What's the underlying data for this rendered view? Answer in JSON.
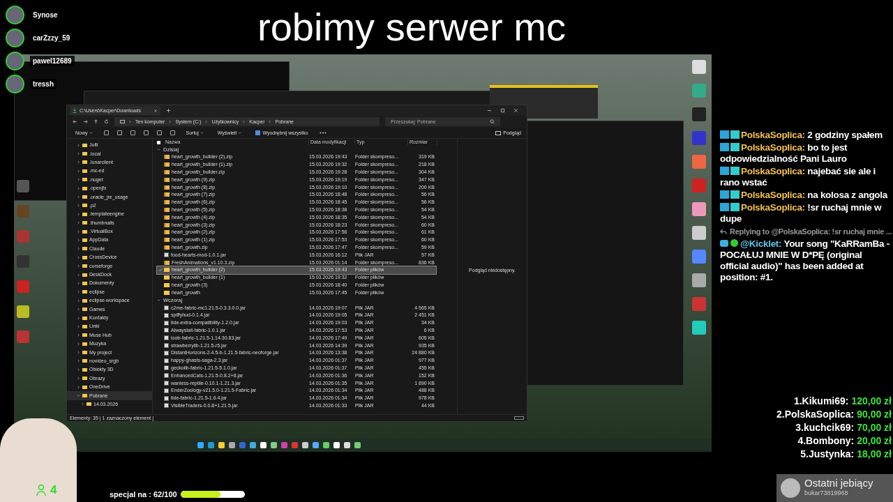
{
  "stream_title": "robimy serwer mc",
  "viewers": [
    {
      "name": "Synose"
    },
    {
      "name": "carZzzy_59"
    },
    {
      "name": "pawel12689"
    },
    {
      "name": "tressh"
    }
  ],
  "explorer": {
    "tab_title": "C:\\Users\\Kacper\\Downloads",
    "breadcrumb": [
      "Ten komputer",
      "System (C:)",
      "Użytkownicy",
      "Kacper",
      "Pobrane"
    ],
    "search": {
      "placeholder": "Przeszukaj: Pobrane"
    },
    "toolbar": [
      {
        "kind": "menu",
        "label": "Nowy"
      },
      {
        "kind": "icon"
      },
      {
        "kind": "icon"
      },
      {
        "kind": "icon"
      },
      {
        "kind": "icon"
      },
      {
        "kind": "icon"
      },
      {
        "kind": "icon"
      },
      {
        "kind": "menu",
        "label": "Sortuj"
      },
      {
        "kind": "menu",
        "label": "Wyświetl"
      },
      {
        "kind": "button",
        "label": "Wyodrębnij wszystko"
      }
    ],
    "select_all": {
      "checked": false
    },
    "preview_button": "Podgląd",
    "sidebar": [
      {
        "label": "Julti",
        "expanded": false,
        "selected": false
      },
      {
        "label": ".local",
        "expanded": false,
        "selected": false
      },
      {
        "label": ".lunarclient",
        "expanded": false,
        "selected": false
      },
      {
        "label": ".mc-ed",
        "expanded": false,
        "selected": false
      },
      {
        "label": ".nuget",
        "expanded": false,
        "selected": false
      },
      {
        "label": ".openjfx",
        "expanded": false,
        "selected": false
      },
      {
        "label": ".oracle_jre_usage",
        "expanded": false,
        "selected": false
      },
      {
        "label": ".p2",
        "expanded": false,
        "selected": false
      },
      {
        "label": ".templateengine",
        "expanded": false,
        "selected": false
      },
      {
        "label": ".thumbnails",
        "expanded": false,
        "selected": false
      },
      {
        "label": ".VirtualBox",
        "expanded": false,
        "selected": false
      },
      {
        "label": "AppData",
        "expanded": false,
        "selected": false
      },
      {
        "label": "Claude",
        "expanded": false,
        "selected": false
      },
      {
        "label": "CrossDevice",
        "expanded": false,
        "selected": false
      },
      {
        "label": "curseforge",
        "expanded": false,
        "selected": false
      },
      {
        "label": "DeskDock",
        "expanded": false,
        "selected": false
      },
      {
        "label": "Dokumenty",
        "expanded": false,
        "selected": false
      },
      {
        "label": "eclipse",
        "expanded": false,
        "selected": false
      },
      {
        "label": "eclipse-workspace",
        "expanded": false,
        "selected": false
      },
      {
        "label": "Games",
        "expanded": false,
        "selected": false
      },
      {
        "label": "Kontakty",
        "expanded": false,
        "selected": false
      },
      {
        "label": "Linki",
        "expanded": false,
        "selected": false
      },
      {
        "label": "Muse Hub",
        "expanded": false,
        "selected": false
      },
      {
        "label": "Muzyka",
        "expanded": false,
        "selected": false
      },
      {
        "label": "My project",
        "expanded": false,
        "selected": false
      },
      {
        "label": "novideo_srgb",
        "expanded": false,
        "selected": false
      },
      {
        "label": "Obiekty 3D",
        "expanded": false,
        "selected": false
      },
      {
        "label": "Obrazy",
        "expanded": false,
        "selected": false
      },
      {
        "label": "OneDrive",
        "expanded": false,
        "selected": false
      },
      {
        "label": "Pobrane",
        "expanded": true,
        "selected": true,
        "children": [
          {
            "label": "14.03.2026",
            "expanded": false,
            "selected": false
          }
        ]
      }
    ],
    "columns": [
      "Nazwa",
      "Data modyfikacji",
      "Typ",
      "Rozmiar"
    ],
    "groups": [
      {
        "label": "Dzisiaj",
        "expanded": true,
        "rows": [
          {
            "kind": "zip",
            "name": "heart_growth_builder (2).zip",
            "date": "15.03.2026 19:43",
            "type": "Folder skompreso...",
            "size": "319 KB",
            "selected": false
          },
          {
            "kind": "zip",
            "name": "heart_growth_builder (1).zip",
            "date": "15.03.2026 19:32",
            "type": "Folder skompreso...",
            "size": "218 KB",
            "selected": false
          },
          {
            "kind": "zip",
            "name": "heart_growth_builder.zip",
            "date": "15.03.2026 19:28",
            "type": "Folder skompreso...",
            "size": "304 KB",
            "selected": false
          },
          {
            "kind": "zip",
            "name": "heart_growth (9).zip",
            "date": "15.03.2026 19:19",
            "type": "Folder skompreso...",
            "size": "347 KB",
            "selected": false
          },
          {
            "kind": "zip",
            "name": "heart_growth (8).zip",
            "date": "15.03.2026 19:10",
            "type": "Folder skompreso...",
            "size": "200 KB",
            "selected": false
          },
          {
            "kind": "zip",
            "name": "heart_growth (7).zip",
            "date": "15.03.2026 18:48",
            "type": "Folder skompreso...",
            "size": "56 KB",
            "selected": false
          },
          {
            "kind": "zip",
            "name": "heart_growth (6).zip",
            "date": "15.03.2026 18:45",
            "type": "Folder skompreso...",
            "size": "56 KB",
            "selected": false
          },
          {
            "kind": "zip",
            "name": "heart_growth (5).zip",
            "date": "15.03.2026 18:38",
            "type": "Folder skompreso...",
            "size": "54 KB",
            "selected": false
          },
          {
            "kind": "zip",
            "name": "heart_growth (4).zip",
            "date": "15.03.2026 18:35",
            "type": "Folder skompreso...",
            "size": "54 KB",
            "selected": false
          },
          {
            "kind": "zip",
            "name": "heart_growth (3).zip",
            "date": "15.03.2026 18:23",
            "type": "Folder skompreso...",
            "size": "60 KB",
            "selected": false
          },
          {
            "kind": "zip",
            "name": "heart_growth (2).zip",
            "date": "15.03.2026 17:56",
            "type": "Folder skompreso...",
            "size": "61 KB",
            "selected": false
          },
          {
            "kind": "zip",
            "name": "heart_growth (1).zip",
            "date": "15.03.2026 17:53",
            "type": "Folder skompreso...",
            "size": "60 KB",
            "selected": false
          },
          {
            "kind": "zip",
            "name": "heart_growth.zip",
            "date": "15.03.2026 17:47",
            "type": "Folder skompreso...",
            "size": "59 KB",
            "selected": false
          },
          {
            "kind": "jar",
            "name": "food-hearts-mod-1.0.1.jar",
            "date": "15.03.2026 16:12",
            "type": "Plik JAR",
            "size": "57 KB",
            "selected": false
          },
          {
            "kind": "zip",
            "name": "FreshAnimations_v1.10.3.zip",
            "date": "15.03.2026 01:14",
            "type": "Folder skompreso...",
            "size": "836 KB",
            "selected": false
          },
          {
            "kind": "folder",
            "name": "heart_growth_builder (2)",
            "date": "15.03.2026 19:43",
            "type": "Folder plików",
            "selected": true
          },
          {
            "kind": "folder",
            "name": "heart_growth_builder (1)",
            "date": "15.03.2026 19:32",
            "type": "Folder plików",
            "selected": false
          },
          {
            "kind": "folder",
            "name": "heart_growth (3)",
            "date": "15.03.2026 18:40",
            "type": "Folder plików",
            "selected": false
          },
          {
            "kind": "folder",
            "name": "heart_growth",
            "date": "15.03.2026 17:45",
            "type": "Folder plików",
            "selected": false
          }
        ]
      },
      {
        "label": "Wczoraj",
        "expanded": true,
        "rows": [
          {
            "kind": "jar",
            "name": "c2me-fabric-mc1.21.5-0.3.3.0.0.jar",
            "date": "14.03.2026 19:07",
            "type": "Plik JAR",
            "size": "4 565 KB",
            "selected": false
          },
          {
            "kind": "jar",
            "name": "spiffyhud-0.1.4.jar",
            "date": "14.03.2026 19:05",
            "type": "Plik JAR",
            "size": "2 451 KB",
            "selected": false
          },
          {
            "kind": "jar",
            "name": "tide-extra-compatibility-1.2.0.jar",
            "date": "14.03.2026 19:03",
            "type": "Plik JAR",
            "size": "34 KB",
            "selected": false
          },
          {
            "kind": "jar",
            "name": "Alwayslait-fabric-1.0.1.jar",
            "date": "14.03.2026 17:53",
            "type": "Plik JAR",
            "size": "6 KB",
            "selected": false
          },
          {
            "kind": "jar",
            "name": "lootr-fabric-1.21.5-1.14.30.83.jar",
            "date": "14.03.2026 17:49",
            "type": "Plik JAR",
            "size": "605 KB",
            "selected": false
          },
          {
            "kind": "jar",
            "name": "strawberrylib-1.21.5-r5.jar",
            "date": "14.03.2026 14:39",
            "type": "Plik JAR",
            "size": "935 KB",
            "selected": false
          },
          {
            "kind": "jar",
            "name": "DistantHorizons-2.4.5-b-1.21.5-fabric-neoforge.jar",
            "date": "14.03.2026 13:38",
            "type": "Plik JAR",
            "size": "24 880 KB",
            "selected": false
          },
          {
            "kind": "jar",
            "name": "happy-ghasts-saga-2.3.jar",
            "date": "14.03.2026 01:37",
            "type": "Plik JAR",
            "size": "977 KB",
            "selected": false
          },
          {
            "kind": "jar",
            "name": "geckolib-fabric-1.21.5-5.1.0.jar",
            "date": "14.03.2026 01:37",
            "type": "Plik JAR",
            "size": "455 KB",
            "selected": false
          },
          {
            "kind": "jar",
            "name": "EnhancedCats-1.21.5-0.8.2+8.jar",
            "date": "14.03.2026 01:36",
            "type": "Plik JAR",
            "size": "152 KB",
            "selected": false
          },
          {
            "kind": "jar",
            "name": "wanless-reptile-0.10.1-1.21.3.jar",
            "date": "14.03.2026 01:35",
            "type": "Plik JAR",
            "size": "1 890 KB",
            "selected": false
          },
          {
            "kind": "jar",
            "name": "EnderZoology-v21.5.0-1.21.5-Fabric.jar",
            "date": "14.03.2026 01:34",
            "type": "Plik JAR",
            "size": "488 KB",
            "selected": false
          },
          {
            "kind": "jar",
            "name": "tide-fabric-1.21.5-1.6.4.jar",
            "date": "14.03.2026 01:34",
            "type": "Plik JAR",
            "size": "978 KB",
            "selected": false
          },
          {
            "kind": "jar",
            "name": "VisibleTraders-0.0.8+1.21.5.jar",
            "date": "14.03.2026 01:33",
            "type": "Plik JAR",
            "size": "44 KB",
            "selected": false
          }
        ]
      }
    ],
    "preview_message": "Podgląd niedostępny.",
    "status": "Elementy: 35 | 1 zaznaczony element |"
  },
  "chat": [
    {
      "kind": "message",
      "user": "PolskaSoplica:",
      "text": "2 godziny spałem"
    },
    {
      "kind": "message",
      "user": "PolskaSoplica:",
      "text": "bo to jest odpowiedzialność Pani Lauro"
    },
    {
      "kind": "message",
      "user": "PolskaSoplica:",
      "text": "najebać sie ale i rano wstać"
    },
    {
      "kind": "message",
      "user": "PolskaSoplica:",
      "text": "na kolosa z angola"
    },
    {
      "kind": "message",
      "user": "PolskaSoplica:",
      "text": "!sr ruchaj mnie w dupe"
    },
    {
      "kind": "reply",
      "text": "Replying to @PolskaSoplica: !sr ruchaj mnie ..."
    },
    {
      "kind": "bot",
      "user": "@Kicklet:",
      "text": "Your song \"KaRRamBa - POCAŁUJ MNIE W D*PĘ (original official audio)\" has been added at position: #1."
    }
  ],
  "donations": [
    {
      "rank": "1.",
      "name": "Kikumi69:",
      "amount": "120,00 zł"
    },
    {
      "rank": "2.",
      "name": "PolskaSoplica:",
      "amount": "90,00 zł"
    },
    {
      "rank": "3.",
      "name": "kuchcik69:",
      "amount": "70,00 zł"
    },
    {
      "rank": "4.",
      "name": "Bombony:",
      "amount": "20,00 zł"
    },
    {
      "rank": "5.",
      "name": "Justynka:",
      "amount": "18,00 zł"
    }
  ],
  "viewer_count": "4",
  "goal": {
    "label": "specjal na : 62/100",
    "level": 0.62
  },
  "last_follower": {
    "title": "Ostatni jebiący",
    "user": "bukar73819968"
  }
}
